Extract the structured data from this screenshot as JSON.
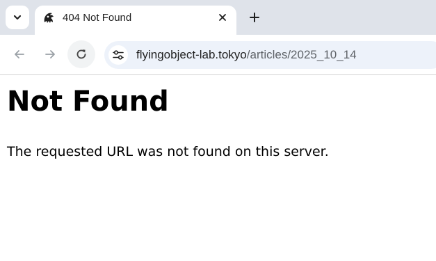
{
  "browser": {
    "tab": {
      "title": "404 Not Found"
    },
    "address_bar": {
      "host": "flyingobject-lab.tokyo",
      "path": "/articles/2025_10_14"
    },
    "icons": {
      "tab_search": "chevron-down-icon",
      "favicon": "site-favicon",
      "close": "close-icon",
      "new_tab": "plus-icon",
      "back": "arrow-left-icon",
      "forward": "arrow-right-icon",
      "reload": "reload-icon",
      "site_info": "tune-icon"
    },
    "colors": {
      "frame": "#dfe3ea",
      "omnibox": "#edf2fa",
      "disabled_icon": "#9aa0a6",
      "active_icon": "#474747"
    }
  },
  "page": {
    "heading": "Not Found",
    "message": "The requested URL was not found on this server."
  }
}
